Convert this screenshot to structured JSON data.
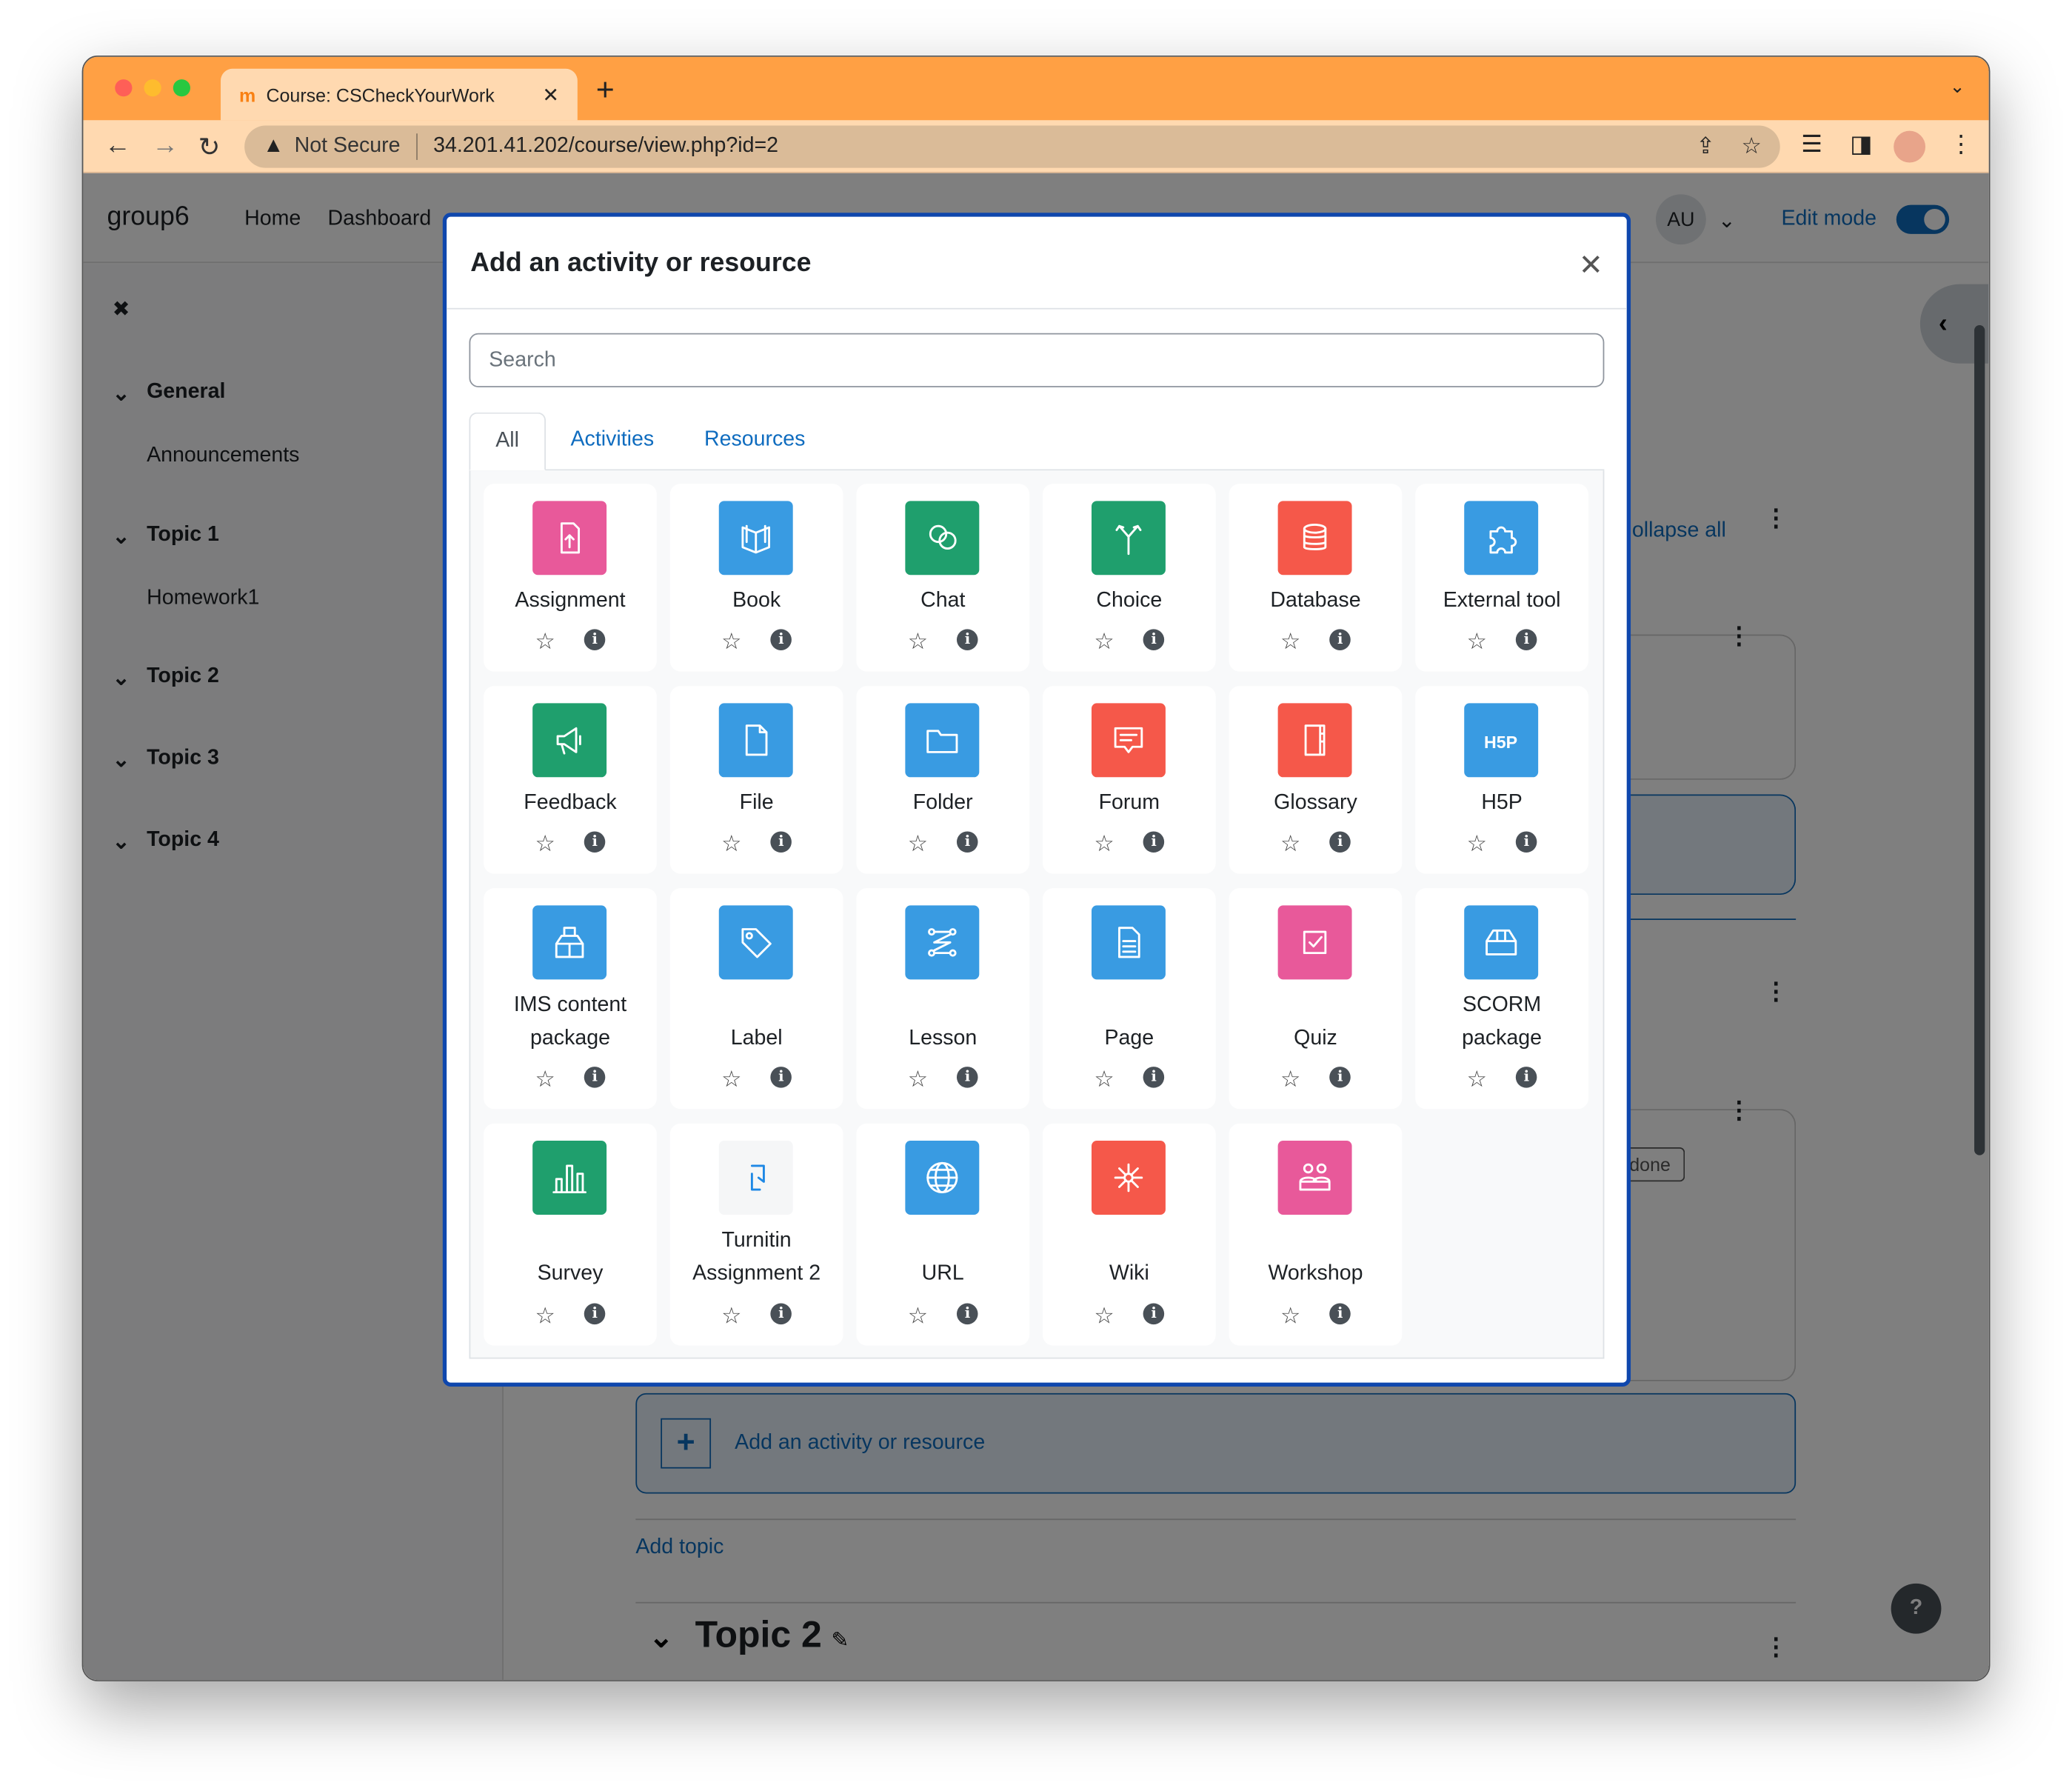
{
  "browser": {
    "tab_title": "Course: CSCheckYourWork",
    "security": "Not Secure",
    "url": "34.201.41.202/course/view.php?id=2"
  },
  "navbar": {
    "brand": "group6",
    "links": [
      "Home",
      "Dashboard"
    ],
    "avatar": "AU",
    "edit_mode": "Edit mode",
    "edit_mode_on": true
  },
  "sidebar": {
    "close": "✖",
    "items": [
      {
        "label": "General",
        "section": true
      },
      {
        "label": "Announcements",
        "section": false
      },
      {
        "label": "Topic 1",
        "section": true
      },
      {
        "label": "Homework1",
        "section": false
      },
      {
        "label": "Topic 2",
        "section": true
      },
      {
        "label": "Topic 3",
        "section": true
      },
      {
        "label": "Topic 4",
        "section": true
      }
    ]
  },
  "main": {
    "collapse_all": "ollapse all",
    "done": "done",
    "add_activity": "Add an activity or resource",
    "add_topic": "Add topic",
    "topic2": "Topic 2",
    "help": "?"
  },
  "modal": {
    "title": "Add an activity or resource",
    "search_placeholder": "Search",
    "tabs": [
      "All",
      "Activities",
      "Resources"
    ],
    "active_tab": "All",
    "colors": {
      "pink": "#e8599a",
      "blue": "#399be2",
      "green": "#1f9f6d",
      "red": "#f5584a",
      "light": "#f5f6f7"
    },
    "items": [
      {
        "name": "Assignment",
        "color": "pink",
        "icon": "assignment-icon"
      },
      {
        "name": "Book",
        "color": "blue",
        "icon": "book-icon"
      },
      {
        "name": "Chat",
        "color": "green",
        "icon": "chat-icon"
      },
      {
        "name": "Choice",
        "color": "green",
        "icon": "choice-icon"
      },
      {
        "name": "Database",
        "color": "red",
        "icon": "database-icon"
      },
      {
        "name": "External tool",
        "color": "blue",
        "icon": "puzzle-icon"
      },
      {
        "name": "Feedback",
        "color": "green",
        "icon": "megaphone-icon"
      },
      {
        "name": "File",
        "color": "blue",
        "icon": "file-icon"
      },
      {
        "name": "Folder",
        "color": "blue",
        "icon": "folder-icon"
      },
      {
        "name": "Forum",
        "color": "red",
        "icon": "forum-icon"
      },
      {
        "name": "Glossary",
        "color": "red",
        "icon": "glossary-icon"
      },
      {
        "name": "H5P",
        "color": "blue",
        "icon": "h5p-icon"
      },
      {
        "name": "IMS content package",
        "color": "blue",
        "icon": "ims-package-icon"
      },
      {
        "name": "Label",
        "color": "blue",
        "icon": "tag-icon"
      },
      {
        "name": "Lesson",
        "color": "blue",
        "icon": "lesson-icon"
      },
      {
        "name": "Page",
        "color": "blue",
        "icon": "page-icon"
      },
      {
        "name": "Quiz",
        "color": "pink",
        "icon": "quiz-icon"
      },
      {
        "name": "SCORM package",
        "color": "blue",
        "icon": "scorm-icon"
      },
      {
        "name": "Survey",
        "color": "green",
        "icon": "survey-chart-icon"
      },
      {
        "name": "Turnitin Assignment 2",
        "color": "light",
        "icon": "turnitin-icon"
      },
      {
        "name": "URL",
        "color": "blue",
        "icon": "globe-icon"
      },
      {
        "name": "Wiki",
        "color": "red",
        "icon": "wiki-icon"
      },
      {
        "name": "Workshop",
        "color": "pink",
        "icon": "workshop-icon"
      }
    ]
  }
}
